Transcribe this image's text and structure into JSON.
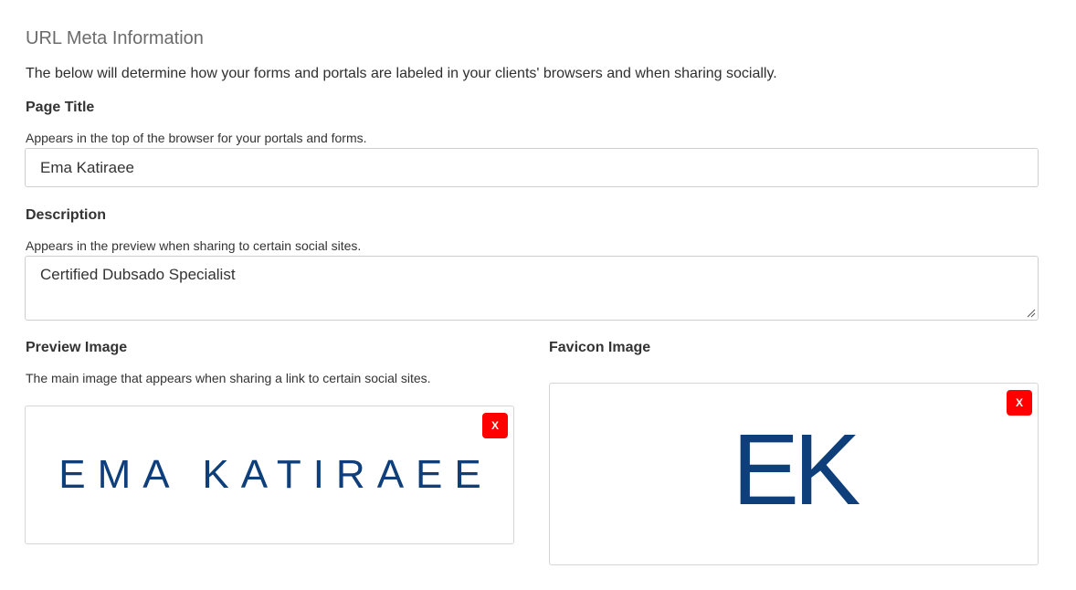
{
  "section": {
    "title": "URL Meta Information",
    "intro": "The below will determine how your forms and portals are labeled in your clients' browsers and when sharing socially."
  },
  "page_title": {
    "label": "Page Title",
    "help": "Appears in the top of the browser for your portals and forms.",
    "value": "Ema Katiraee"
  },
  "description": {
    "label": "Description",
    "help": "Appears in the preview when sharing to certain social sites.",
    "value": "Certified Dubsado Specialist"
  },
  "preview_image": {
    "label": "Preview Image",
    "help": "The main image that appears when sharing a link to certain social sites.",
    "image_text": "EMA KATIRAEE",
    "remove_label": "X"
  },
  "favicon_image": {
    "label": "Favicon Image",
    "image_text": "EK",
    "remove_label": "X"
  },
  "colors": {
    "brand_navy": "#0e3f7a",
    "remove_red": "#ff0000",
    "border_gray": "#cfcfcf"
  }
}
